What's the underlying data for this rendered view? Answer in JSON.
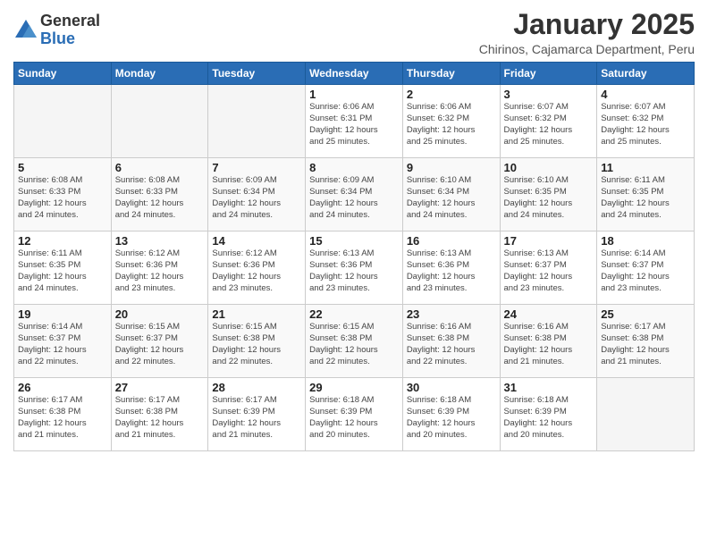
{
  "logo": {
    "general": "General",
    "blue": "Blue"
  },
  "title": {
    "month": "January 2025",
    "location": "Chirinos, Cajamarca Department, Peru"
  },
  "weekdays": [
    "Sunday",
    "Monday",
    "Tuesday",
    "Wednesday",
    "Thursday",
    "Friday",
    "Saturday"
  ],
  "weeks": [
    [
      {
        "day": "",
        "info": ""
      },
      {
        "day": "",
        "info": ""
      },
      {
        "day": "",
        "info": ""
      },
      {
        "day": "1",
        "info": "Sunrise: 6:06 AM\nSunset: 6:31 PM\nDaylight: 12 hours\nand 25 minutes."
      },
      {
        "day": "2",
        "info": "Sunrise: 6:06 AM\nSunset: 6:32 PM\nDaylight: 12 hours\nand 25 minutes."
      },
      {
        "day": "3",
        "info": "Sunrise: 6:07 AM\nSunset: 6:32 PM\nDaylight: 12 hours\nand 25 minutes."
      },
      {
        "day": "4",
        "info": "Sunrise: 6:07 AM\nSunset: 6:32 PM\nDaylight: 12 hours\nand 25 minutes."
      }
    ],
    [
      {
        "day": "5",
        "info": "Sunrise: 6:08 AM\nSunset: 6:33 PM\nDaylight: 12 hours\nand 24 minutes."
      },
      {
        "day": "6",
        "info": "Sunrise: 6:08 AM\nSunset: 6:33 PM\nDaylight: 12 hours\nand 24 minutes."
      },
      {
        "day": "7",
        "info": "Sunrise: 6:09 AM\nSunset: 6:34 PM\nDaylight: 12 hours\nand 24 minutes."
      },
      {
        "day": "8",
        "info": "Sunrise: 6:09 AM\nSunset: 6:34 PM\nDaylight: 12 hours\nand 24 minutes."
      },
      {
        "day": "9",
        "info": "Sunrise: 6:10 AM\nSunset: 6:34 PM\nDaylight: 12 hours\nand 24 minutes."
      },
      {
        "day": "10",
        "info": "Sunrise: 6:10 AM\nSunset: 6:35 PM\nDaylight: 12 hours\nand 24 minutes."
      },
      {
        "day": "11",
        "info": "Sunrise: 6:11 AM\nSunset: 6:35 PM\nDaylight: 12 hours\nand 24 minutes."
      }
    ],
    [
      {
        "day": "12",
        "info": "Sunrise: 6:11 AM\nSunset: 6:35 PM\nDaylight: 12 hours\nand 24 minutes."
      },
      {
        "day": "13",
        "info": "Sunrise: 6:12 AM\nSunset: 6:36 PM\nDaylight: 12 hours\nand 23 minutes."
      },
      {
        "day": "14",
        "info": "Sunrise: 6:12 AM\nSunset: 6:36 PM\nDaylight: 12 hours\nand 23 minutes."
      },
      {
        "day": "15",
        "info": "Sunrise: 6:13 AM\nSunset: 6:36 PM\nDaylight: 12 hours\nand 23 minutes."
      },
      {
        "day": "16",
        "info": "Sunrise: 6:13 AM\nSunset: 6:36 PM\nDaylight: 12 hours\nand 23 minutes."
      },
      {
        "day": "17",
        "info": "Sunrise: 6:13 AM\nSunset: 6:37 PM\nDaylight: 12 hours\nand 23 minutes."
      },
      {
        "day": "18",
        "info": "Sunrise: 6:14 AM\nSunset: 6:37 PM\nDaylight: 12 hours\nand 23 minutes."
      }
    ],
    [
      {
        "day": "19",
        "info": "Sunrise: 6:14 AM\nSunset: 6:37 PM\nDaylight: 12 hours\nand 22 minutes."
      },
      {
        "day": "20",
        "info": "Sunrise: 6:15 AM\nSunset: 6:37 PM\nDaylight: 12 hours\nand 22 minutes."
      },
      {
        "day": "21",
        "info": "Sunrise: 6:15 AM\nSunset: 6:38 PM\nDaylight: 12 hours\nand 22 minutes."
      },
      {
        "day": "22",
        "info": "Sunrise: 6:15 AM\nSunset: 6:38 PM\nDaylight: 12 hours\nand 22 minutes."
      },
      {
        "day": "23",
        "info": "Sunrise: 6:16 AM\nSunset: 6:38 PM\nDaylight: 12 hours\nand 22 minutes."
      },
      {
        "day": "24",
        "info": "Sunrise: 6:16 AM\nSunset: 6:38 PM\nDaylight: 12 hours\nand 21 minutes."
      },
      {
        "day": "25",
        "info": "Sunrise: 6:17 AM\nSunset: 6:38 PM\nDaylight: 12 hours\nand 21 minutes."
      }
    ],
    [
      {
        "day": "26",
        "info": "Sunrise: 6:17 AM\nSunset: 6:38 PM\nDaylight: 12 hours\nand 21 minutes."
      },
      {
        "day": "27",
        "info": "Sunrise: 6:17 AM\nSunset: 6:38 PM\nDaylight: 12 hours\nand 21 minutes."
      },
      {
        "day": "28",
        "info": "Sunrise: 6:17 AM\nSunset: 6:39 PM\nDaylight: 12 hours\nand 21 minutes."
      },
      {
        "day": "29",
        "info": "Sunrise: 6:18 AM\nSunset: 6:39 PM\nDaylight: 12 hours\nand 20 minutes."
      },
      {
        "day": "30",
        "info": "Sunrise: 6:18 AM\nSunset: 6:39 PM\nDaylight: 12 hours\nand 20 minutes."
      },
      {
        "day": "31",
        "info": "Sunrise: 6:18 AM\nSunset: 6:39 PM\nDaylight: 12 hours\nand 20 minutes."
      },
      {
        "day": "",
        "info": ""
      }
    ]
  ]
}
